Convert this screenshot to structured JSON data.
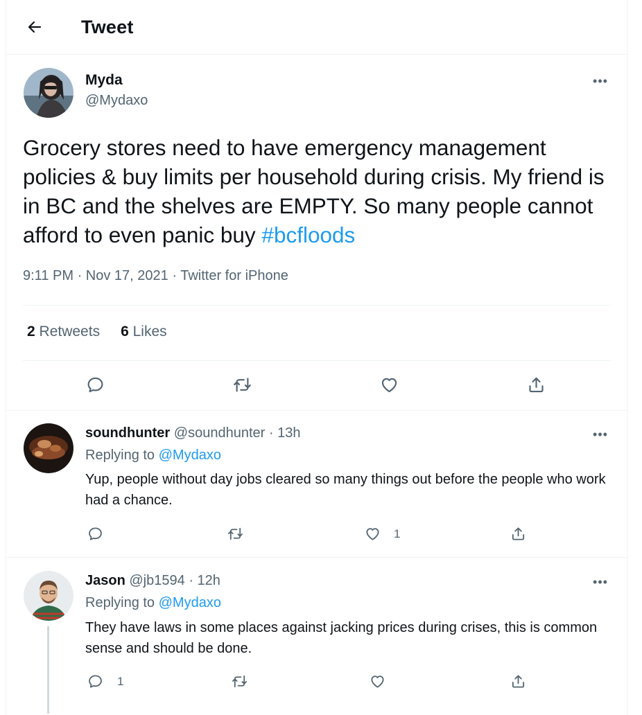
{
  "header": {
    "title": "Tweet",
    "back_icon": "arrow-left-icon"
  },
  "tweet": {
    "display_name": "Myda",
    "handle": "@Mydaxo",
    "text": "Grocery stores need to have emergency management policies & buy limits per household during crisis. My friend is in BC and the shelves are EMPTY. So many people cannot afford to even panic buy ",
    "hashtag": "#bcfloods",
    "time": "9:11 PM",
    "date": "Nov 17, 2021",
    "source": "Twitter for iPhone",
    "retweet_count": "2",
    "retweet_label": "Retweets",
    "like_count": "6",
    "like_label": "Likes",
    "actions": [
      "reply-icon",
      "retweet-icon",
      "like-icon",
      "share-icon"
    ]
  },
  "replies": [
    {
      "display_name": "soundhunter",
      "handle": "@soundhunter",
      "time": "13h",
      "replying_label": "Replying to",
      "replying_to": "@Mydaxo",
      "text": "Yup, people without day jobs cleared so many things out before the people who work had a chance.",
      "reply_count": "",
      "like_count": "1"
    },
    {
      "display_name": "Jason",
      "handle": "@jb1594",
      "time": "12h",
      "replying_label": "Replying to",
      "replying_to": "@Mydaxo",
      "text": "They have laws in some places against jacking prices during crises, this is common sense and should be done.",
      "reply_count": "1",
      "like_count": ""
    }
  ],
  "separator": "·",
  "colors": {
    "accent": "#1d9bf0",
    "secondary_text": "#536471",
    "border": "#eff3f4"
  }
}
